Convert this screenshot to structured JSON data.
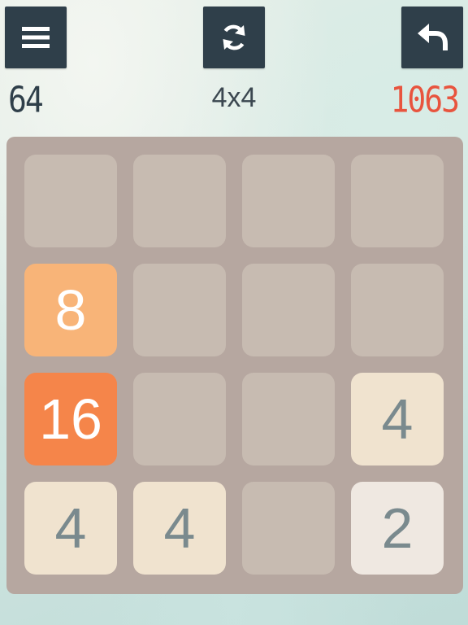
{
  "header": {
    "menu_icon": "hamburger-menu-icon",
    "restart_icon": "refresh-icon",
    "undo_icon": "undo-arrow-icon",
    "current_score": "64",
    "grid_size": "4x4",
    "best_score": "1063"
  },
  "colors": {
    "button_bg": "#2f3f4a",
    "current_score": "#2f3f4a",
    "best_score": "#e8543e",
    "board_bg": "#b6a7a0",
    "empty_tile": "#c7bbb1",
    "tile_2": "#efe8e1",
    "tile_4": "#f0e3cf",
    "tile_8": "#f8b478",
    "tile_16": "#f5854a"
  },
  "board": {
    "rows": [
      [
        "",
        "",
        "",
        ""
      ],
      [
        "8",
        "",
        "",
        ""
      ],
      [
        "16",
        "",
        "",
        "4"
      ],
      [
        "4",
        "4",
        "",
        "2"
      ]
    ]
  }
}
